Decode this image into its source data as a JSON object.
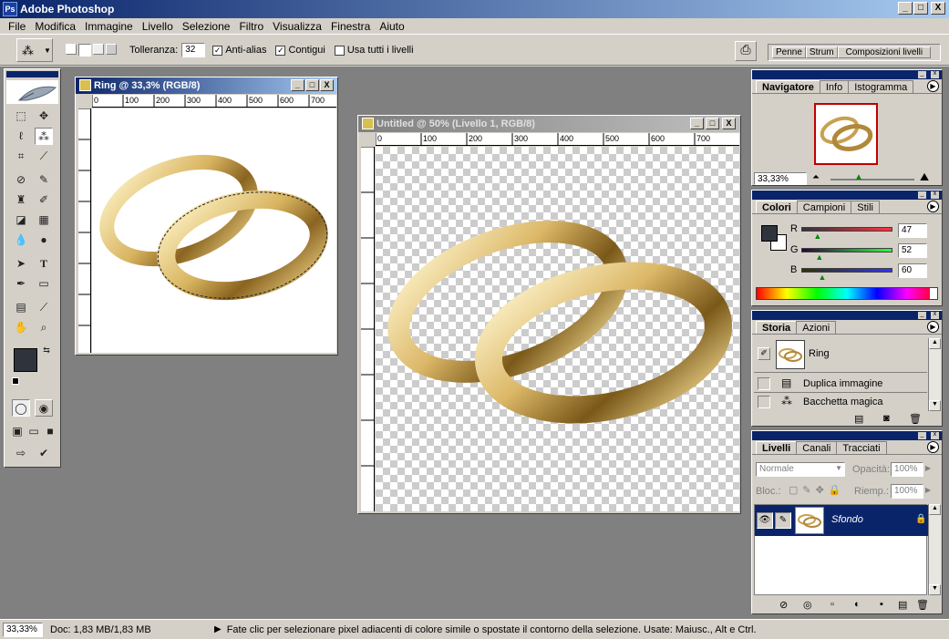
{
  "app": {
    "title": "Adobe Photoshop",
    "icon": "ps-icon"
  },
  "window_buttons": {
    "minimize": "_",
    "maximize": "□",
    "close": "X"
  },
  "menu": [
    "File",
    "Modifica",
    "Immagine",
    "Livello",
    "Selezione",
    "Filtro",
    "Visualizza",
    "Finestra",
    "Aiuto"
  ],
  "options": {
    "tolerance_label": "Tolleranza:",
    "tolerance_value": "32",
    "antialias": "Anti-alias",
    "contiguous": "Contigui",
    "all_layers": "Usa tutti i livelli",
    "well_tabs": [
      "Penne",
      "Strum",
      "Composizioni livelli"
    ]
  },
  "doc1": {
    "title": "Ring @ 33,3% (RGB/8)",
    "ruler": [
      "0",
      "100",
      "200",
      "300",
      "400",
      "500",
      "600",
      "700"
    ]
  },
  "doc2": {
    "title": "Untitled @ 50% (Livello 1, RGB/8)",
    "ruler": [
      "0",
      "100",
      "200",
      "300",
      "400",
      "500",
      "600",
      "700"
    ]
  },
  "navigator": {
    "tabs": [
      "Navigatore",
      "Info",
      "Istogramma"
    ],
    "zoom": "33,33%"
  },
  "colors": {
    "tabs": [
      "Colori",
      "Campioni",
      "Stili"
    ],
    "r_label": "R",
    "g_label": "G",
    "b_label": "B",
    "r": "47",
    "g": "52",
    "b": "60",
    "r_level": 0.184,
    "g_level": 0.204,
    "b_level": 0.235,
    "foreground": "#2f343c"
  },
  "history": {
    "tabs": [
      "Storia",
      "Azioni"
    ],
    "snapshot": "Ring",
    "items": [
      "Duplica immagine",
      "Bacchetta magica"
    ]
  },
  "layers": {
    "tabs": [
      "Livelli",
      "Canali",
      "Tracciati"
    ],
    "blend": "Normale",
    "opacity_label": "Opacità:",
    "opacity": "100%",
    "lock_label": "Bloc.:",
    "fill_label": "Riemp.:",
    "fill": "100%",
    "layer_name": "Sfondo"
  },
  "status": {
    "zoom": "33,33%",
    "doc": "Doc: 1,83 MB/1,83 MB",
    "hint": "Fate clic per selezionare pixel adiacenti di colore simile o spostate il contorno della selezione.  Usate: Maiusc., Alt e Ctrl."
  }
}
